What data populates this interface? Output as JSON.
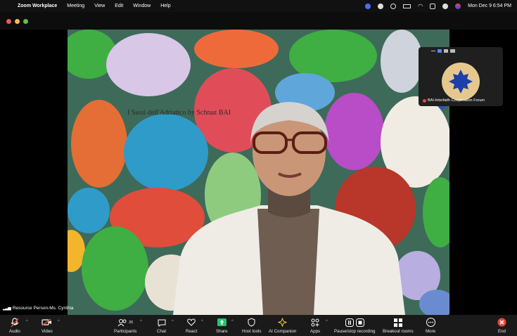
{
  "menubar": {
    "app_name": "Zoom Workplace",
    "items": [
      "Meeting",
      "View",
      "Edit",
      "Window",
      "Help"
    ],
    "clock": "Mon Dec 9  6:54 PM"
  },
  "video": {
    "overlay_caption": "I Sassi dell'Adriatico by Schnaz BAI",
    "participant_name": "Resource Person-Ms. Cynthia"
  },
  "self_view": {
    "label": "BAI-Interfaith Cooperation Forum"
  },
  "toolbar": {
    "audio": "Audio",
    "video": "Video",
    "participants": "Participants",
    "participants_count": "26",
    "chat": "Chat",
    "react": "React",
    "share": "Share",
    "host_tools": "Host tools",
    "ai_companion": "AI Companion",
    "apps": "Apps",
    "recording": "Pause/stop recording",
    "breakout": "Breakout rooms",
    "more": "More",
    "end": "End"
  },
  "colors": {
    "share_accent": "#27c36b",
    "end_red": "#e5483d",
    "mic_muted": "#e5483d"
  }
}
